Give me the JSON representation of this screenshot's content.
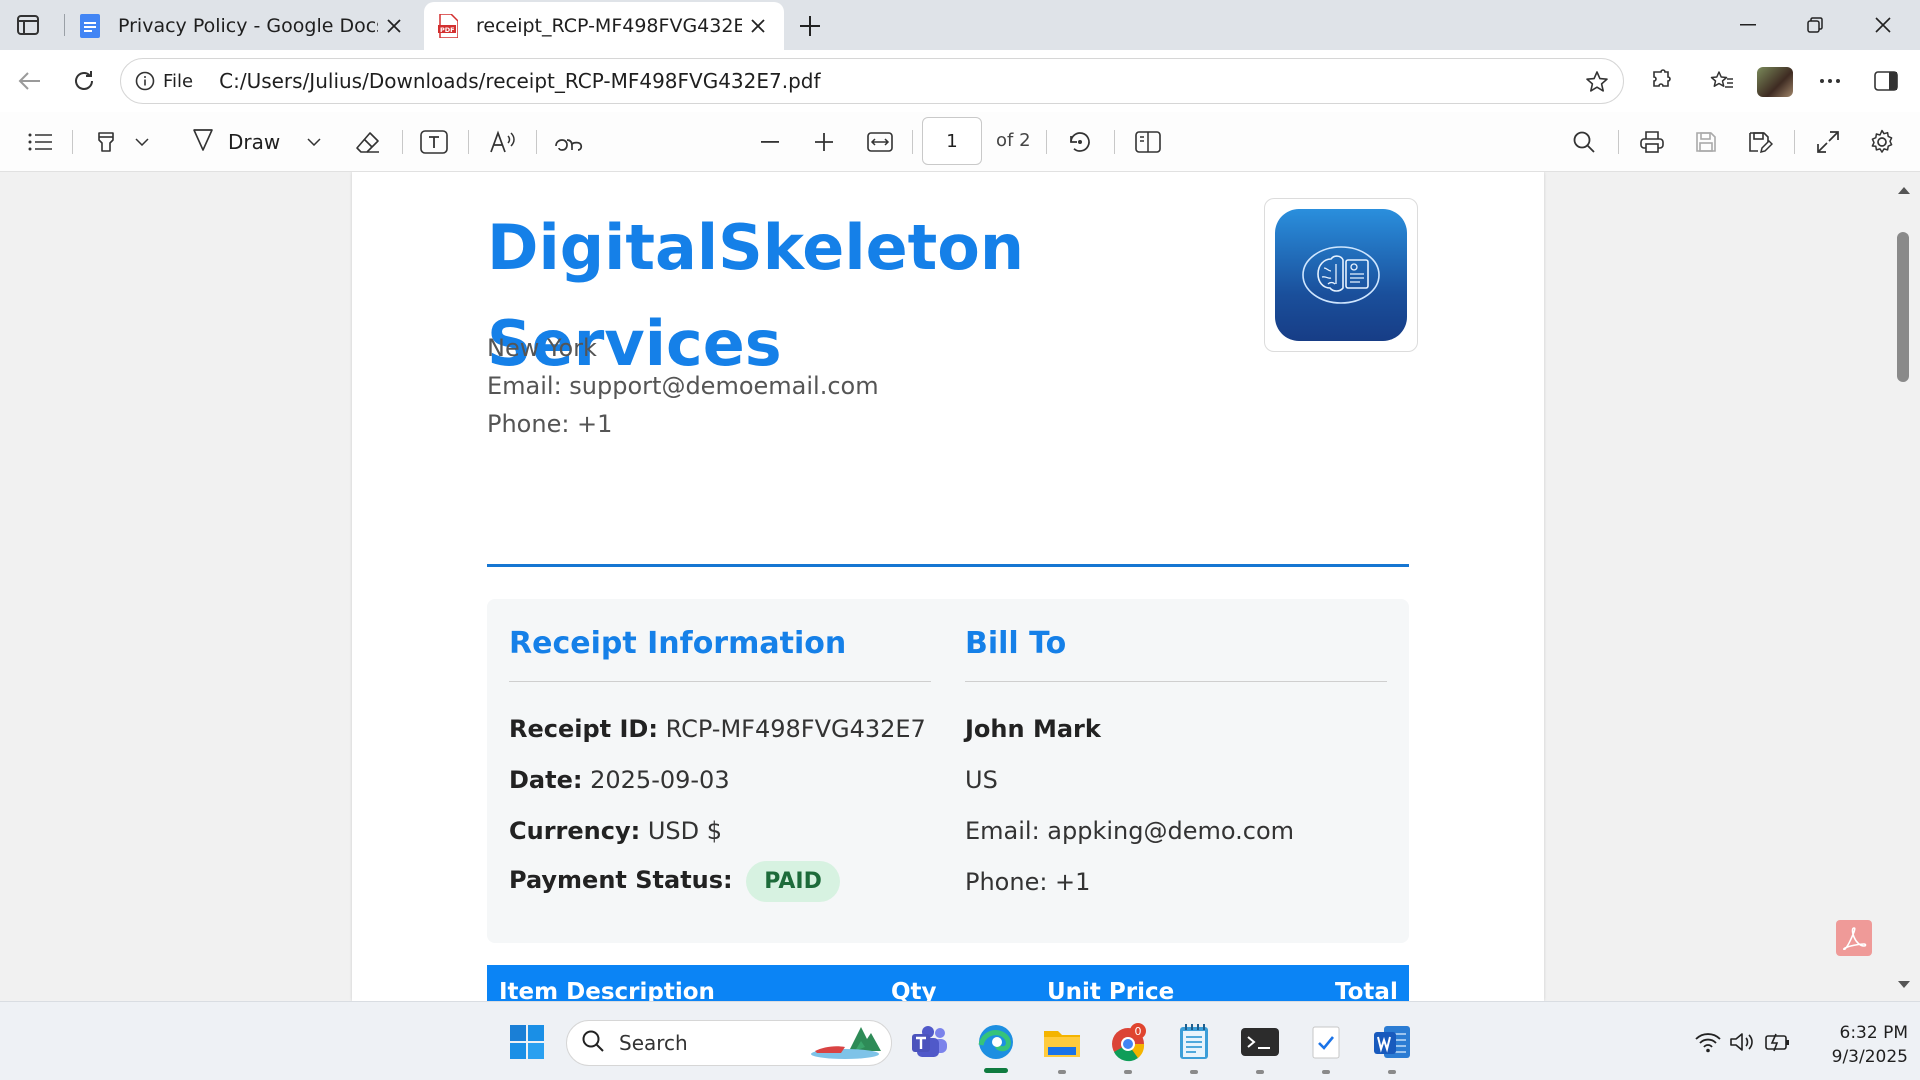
{
  "browser": {
    "tabs": [
      {
        "title": "Privacy Policy - Google Docs",
        "icon": "google-docs-icon",
        "active": false
      },
      {
        "title": "receipt_RCP-MF498FVG432E7.pdf",
        "icon": "pdf-icon",
        "active": true
      }
    ],
    "address": {
      "scheme_label": "File",
      "url": "C:/Users/Julius/Downloads/receipt_RCP-MF498FVG432E7.pdf"
    }
  },
  "pdf_toolbar": {
    "draw_label": "Draw",
    "current_page": "1",
    "page_total": "of 2"
  },
  "receipt": {
    "company_line1": "DigitalSkeleton",
    "company_line2": "Services",
    "city": "New York",
    "email": "Email: support@demoemail.com",
    "phone": "Phone: +1",
    "receipt_info": {
      "heading": "Receipt Information",
      "id_label": "Receipt ID:",
      "id_value": "RCP-MF498FVG432E7",
      "date_label": "Date:",
      "date_value": "2025-09-03",
      "currency_label": "Currency:",
      "currency_value": "USD $",
      "status_label": "Payment Status:",
      "status_value": "PAID"
    },
    "bill_to": {
      "heading": "Bill To",
      "name": "John Mark",
      "country": "US",
      "email": "Email: appking@demo.com",
      "phone": "Phone: +1"
    },
    "items_table": {
      "columns": [
        "Item Description",
        "Qty",
        "Unit Price",
        "Total"
      ]
    }
  },
  "taskbar": {
    "search_label": "Search",
    "chrome_badge": "0",
    "time": "6:32 PM",
    "date": "9/3/2025"
  },
  "colors": {
    "accent": "#1580e8",
    "table_header": "#0b84f5",
    "paid_badge_bg": "#d7f2e1",
    "paid_badge_text": "#1d6b3a"
  }
}
